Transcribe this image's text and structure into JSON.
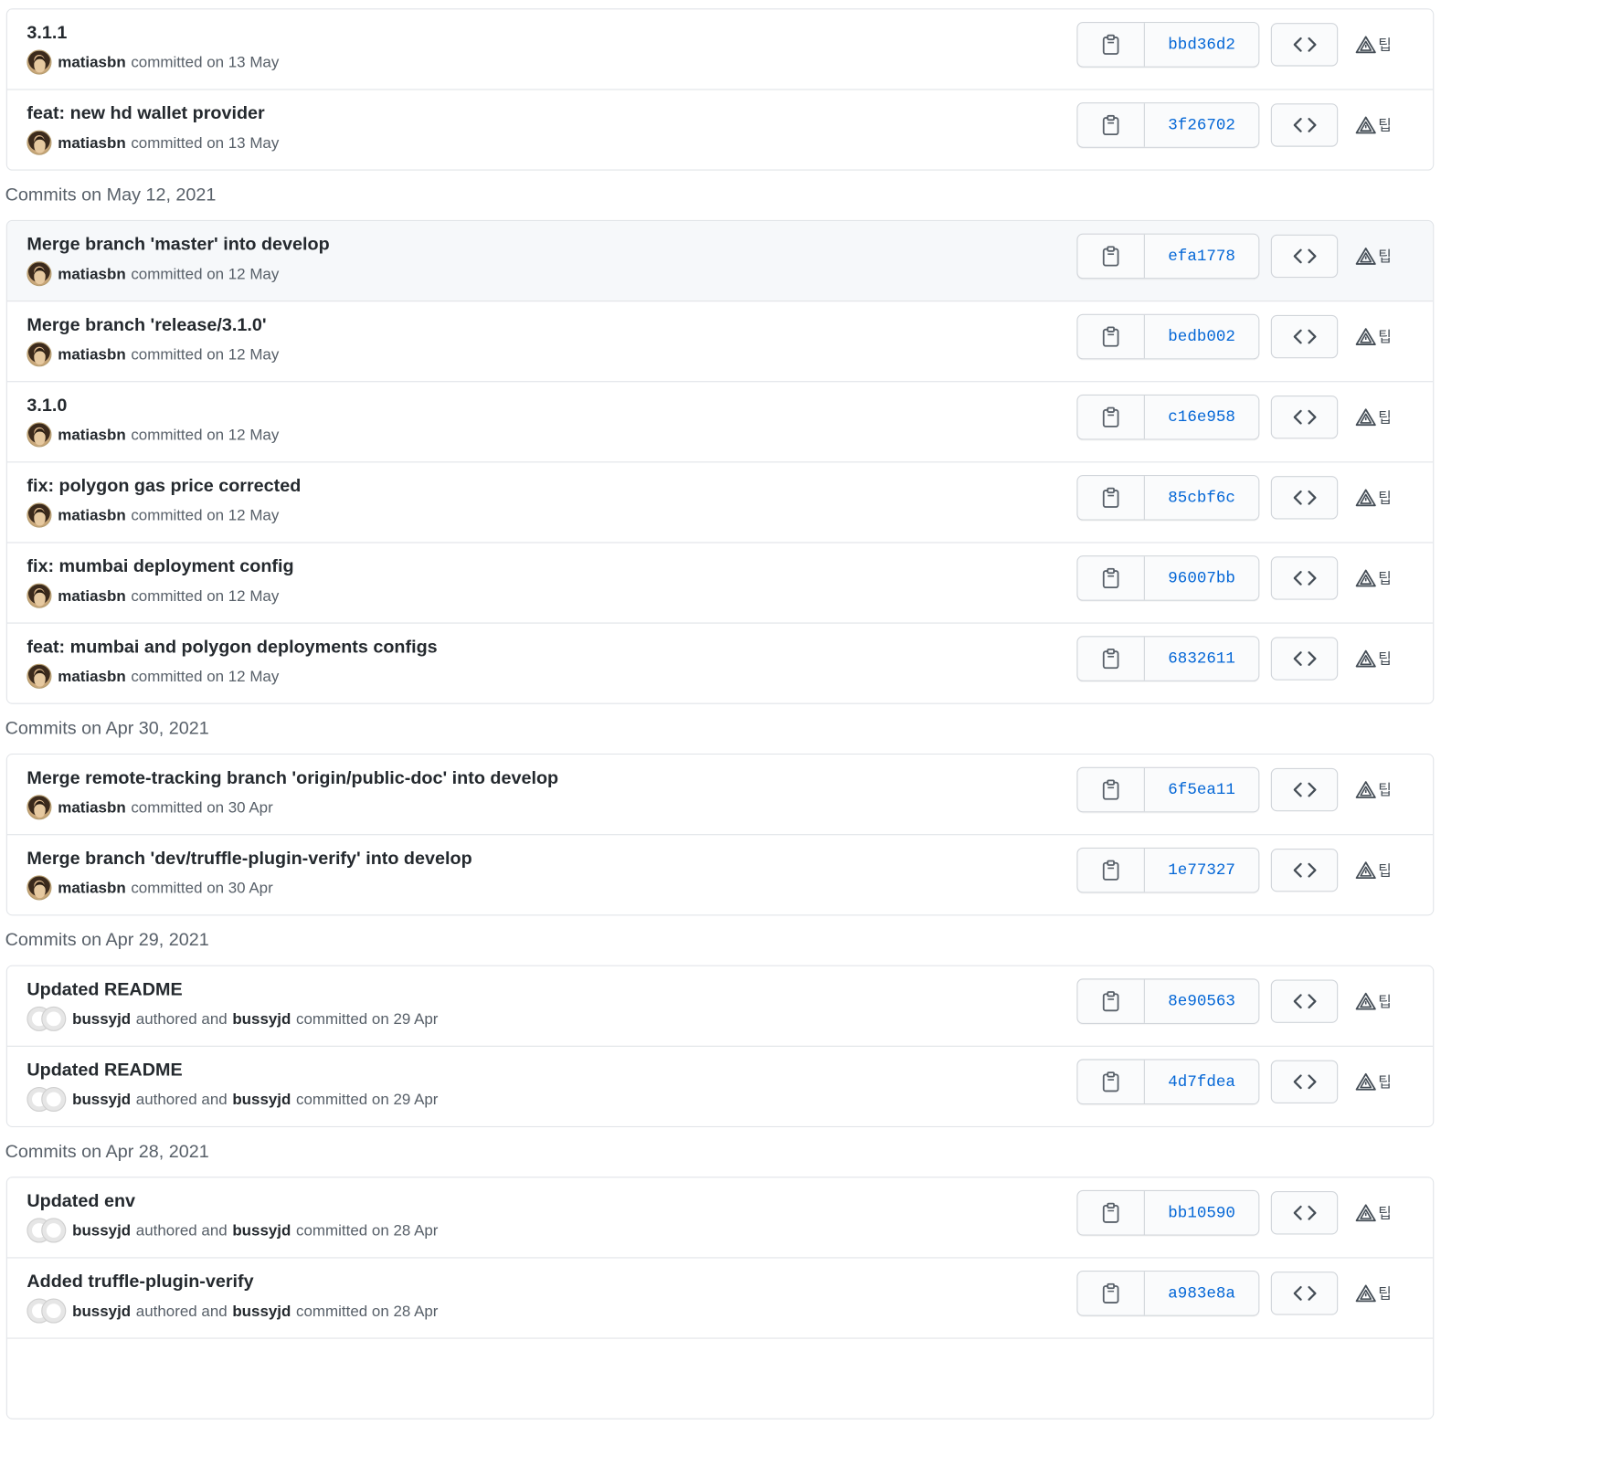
{
  "groups": [
    {
      "header": "",
      "commits": [
        {
          "title": "3.1.1",
          "author": "matiasbn",
          "pair": false,
          "text1": "committed on 13 May",
          "sha": "bbd36d2"
        },
        {
          "title": "feat: new hd wallet provider",
          "author": "matiasbn",
          "pair": false,
          "text1": "committed on 13 May",
          "sha": "3f26702"
        }
      ]
    },
    {
      "header": "Commits on May 12, 2021",
      "commits": [
        {
          "title": "Merge branch 'master' into develop",
          "author": "matiasbn",
          "pair": false,
          "text1": "committed on 12 May",
          "sha": "efa1778",
          "hover": true
        },
        {
          "title": "Merge branch 'release/3.1.0'",
          "author": "matiasbn",
          "pair": false,
          "text1": "committed on 12 May",
          "sha": "bedb002"
        },
        {
          "title": "3.1.0",
          "author": "matiasbn",
          "pair": false,
          "text1": "committed on 12 May",
          "sha": "c16e958"
        },
        {
          "title": "fix: polygon gas price corrected",
          "author": "matiasbn",
          "pair": false,
          "text1": "committed on 12 May",
          "sha": "85cbf6c"
        },
        {
          "title": "fix: mumbai deployment config",
          "author": "matiasbn",
          "pair": false,
          "text1": "committed on 12 May",
          "sha": "96007bb"
        },
        {
          "title": "feat: mumbai and polygon deployments configs",
          "author": "matiasbn",
          "pair": false,
          "text1": "committed on 12 May",
          "sha": "6832611"
        }
      ]
    },
    {
      "header": "Commits on Apr 30, 2021",
      "commits": [
        {
          "title": "Merge remote-tracking branch 'origin/public-doc' into develop",
          "author": "matiasbn",
          "pair": false,
          "text1": "committed on 30 Apr",
          "sha": "6f5ea11"
        },
        {
          "title": "Merge branch 'dev/truffle-plugin-verify' into develop",
          "author": "matiasbn",
          "pair": false,
          "text1": "committed on 30 Apr",
          "sha": "1e77327"
        }
      ]
    },
    {
      "header": "Commits on Apr 29, 2021",
      "commits": [
        {
          "title": "Updated README",
          "author": "bussyjd",
          "pair": true,
          "text1": "authored and",
          "committer": "bussyjd",
          "text2": "committed on 29 Apr",
          "sha": "8e90563"
        },
        {
          "title": "Updated README",
          "author": "bussyjd",
          "pair": true,
          "text1": "authored and",
          "committer": "bussyjd",
          "text2": "committed on 29 Apr",
          "sha": "4d7fdea"
        }
      ]
    },
    {
      "header": "Commits on Apr 28, 2021",
      "commits": [
        {
          "title": "Updated env",
          "author": "bussyjd",
          "pair": true,
          "text1": "authored and",
          "committer": "bussyjd",
          "text2": "committed on 28 Apr",
          "sha": "bb10590"
        },
        {
          "title": "Added truffle-plugin-verify",
          "author": "bussyjd",
          "pair": true,
          "text1": "authored and",
          "committer": "bussyjd",
          "text2": "committed on 28 Apr",
          "sha": "a983e8a"
        },
        {
          "title": "",
          "author": "",
          "pair": false,
          "text1": "",
          "sha": ""
        }
      ]
    }
  ],
  "extra_glyph": "팁",
  "icons": {
    "copy": "clipboard-icon",
    "browse": "code-icon",
    "extension": "warning-triangle-icon"
  },
  "colors": {
    "sha_link": "#0366d6",
    "border": "#e1e4e8",
    "hover_row": "#f6f8fa",
    "muted_text": "#586069"
  }
}
